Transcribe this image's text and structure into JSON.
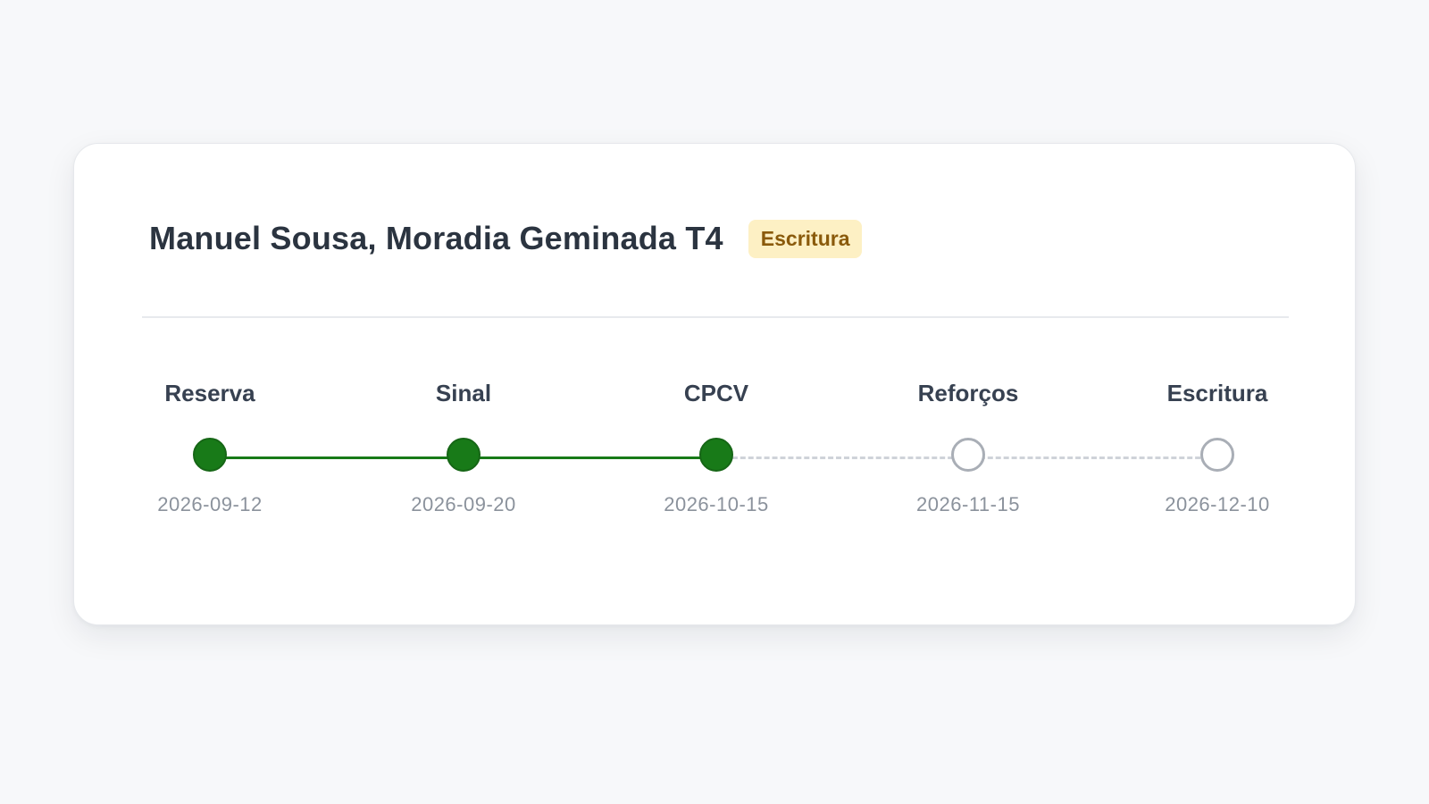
{
  "card": {
    "title": "Manuel Sousa, Moradia Geminada T4",
    "badge": "Escritura"
  },
  "timeline": {
    "steps": [
      {
        "label": "Reserva",
        "date": "2026-09-12",
        "status": "done"
      },
      {
        "label": "Sinal",
        "date": "2026-09-20",
        "status": "done"
      },
      {
        "label": "CPCV",
        "date": "2026-10-15",
        "status": "done"
      },
      {
        "label": "Reforços",
        "date": "2026-11-15",
        "status": "pending"
      },
      {
        "label": "Escritura",
        "date": "2026-12-10",
        "status": "pending"
      }
    ]
  },
  "colors": {
    "done": "#187a18",
    "pending": "#a9aeb6",
    "badge_bg": "#fdf0c4",
    "badge_text": "#8a5a0b"
  }
}
